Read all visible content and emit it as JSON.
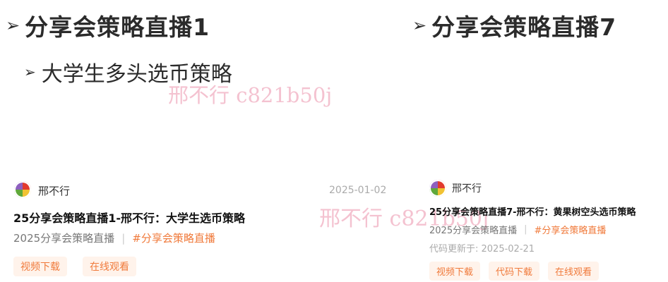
{
  "left": {
    "heading_arrow": "➢",
    "heading": "分享会策略直播1",
    "subheading_arrow": "➢",
    "subheading": "大学生多头选币策略",
    "watermark": "邢不行 c821b50j",
    "card": {
      "author": "邢不行",
      "date": "2025-01-02",
      "title": "25分享会策略直播1-邢不行：大学生选币策略",
      "category": "2025分享会策略直播",
      "separator": "|",
      "tag": "#分享会策略直播",
      "buttons": [
        "视频下载",
        "在线观看"
      ]
    }
  },
  "right": {
    "heading_arrow": "➢",
    "heading": "分享会策略直播7",
    "watermark": "邢不行 c821b50j",
    "card": {
      "author": "邢不行",
      "title": "25分享会策略直播7-邢不行：黄果树空头选币策略",
      "category": "2025分享会策略直播",
      "separator": "|",
      "tag": "#分享会策略直播",
      "code_update": "代码更新于: 2025-02-21",
      "buttons": [
        "视频下载",
        "代码下载",
        "在线观看"
      ]
    }
  }
}
